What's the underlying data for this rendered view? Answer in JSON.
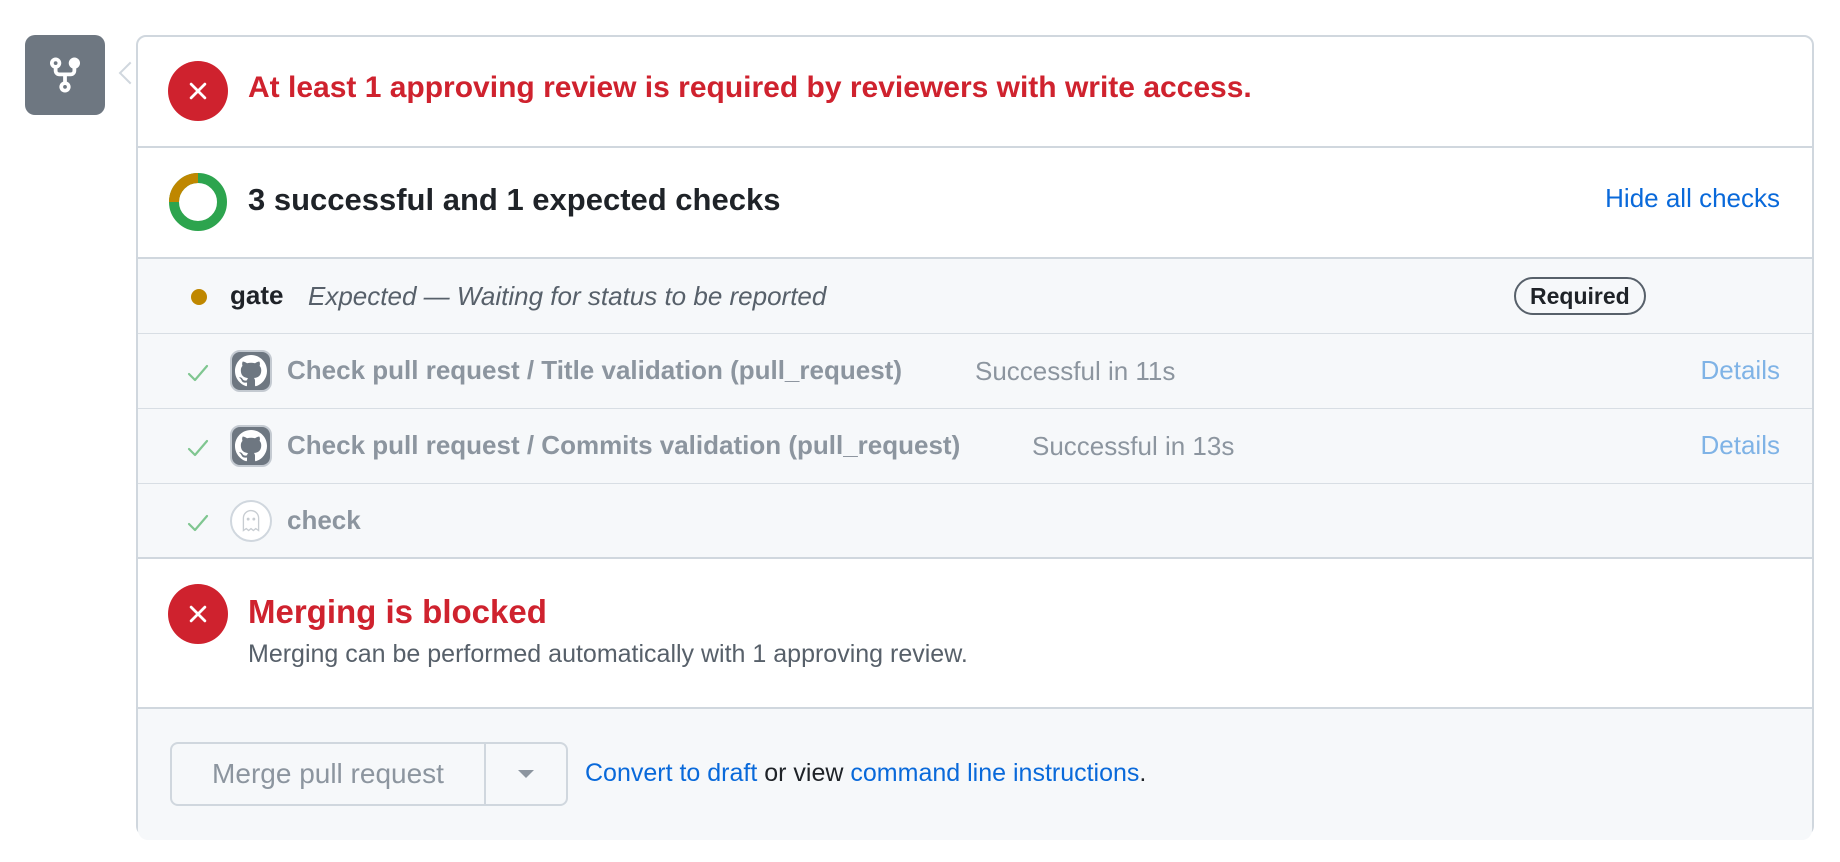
{
  "review": {
    "message": "At least 1 approving review is required by reviewers with write access."
  },
  "checks_summary": {
    "title": "3 successful and 1 expected checks",
    "toggle_label": "Hide all checks"
  },
  "checks": [
    {
      "name": "gate",
      "description": "Expected — Waiting for status to be reported",
      "badge": "Required",
      "status": "expected"
    },
    {
      "name": "Check pull request / Title validation (pull_request)",
      "status_text": "Successful in 11s",
      "details_label": "Details",
      "avatar": "github-actions-icon"
    },
    {
      "name": "Check pull request / Commits validation (pull_request)",
      "status_text": "Successful in 13s",
      "details_label": "Details",
      "avatar": "github-actions-icon"
    },
    {
      "name": "check",
      "avatar": "ghost-app-icon"
    }
  ],
  "merge_status": {
    "title": "Merging is blocked",
    "description": "Merging can be performed automatically with 1 approving review."
  },
  "footer": {
    "merge_button_label": "Merge pull request",
    "convert_link": "Convert to draft",
    "middle_text": " or view ",
    "cli_link": "command line instructions",
    "end_text": "."
  },
  "colors": {
    "error": "#cf222e",
    "success": "#2da44e",
    "pending": "#bf8700",
    "link": "#0969da"
  }
}
